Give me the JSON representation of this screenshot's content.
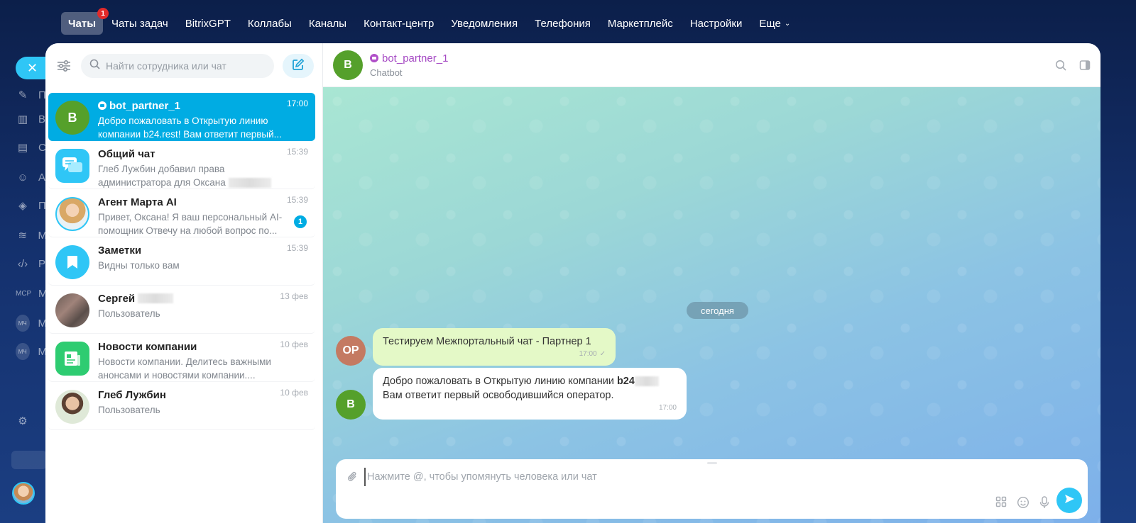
{
  "topnav": {
    "items": [
      {
        "label": "Чаты",
        "badge": "1"
      },
      {
        "label": "Чаты задач"
      },
      {
        "label": "BitrixGPT"
      },
      {
        "label": "Коллабы"
      },
      {
        "label": "Каналы"
      },
      {
        "label": "Контакт-центр"
      },
      {
        "label": "Уведомления"
      },
      {
        "label": "Телефония"
      },
      {
        "label": "Маркетплейс"
      },
      {
        "label": "Настройки"
      },
      {
        "label": "Еще"
      }
    ]
  },
  "rail": {
    "letters": [
      "П",
      "В",
      "С",
      "А",
      "П",
      "М",
      "Р",
      "М",
      "М",
      "М"
    ],
    "mcp": "MCP",
    "mch": "МЧ"
  },
  "sidebar": {
    "search_placeholder": "Найти сотрудника или чат",
    "chats": [
      {
        "name": "bot_partner_1",
        "time": "17:00",
        "preview": "Добро пожаловать в Открытую линию компании b24.rest! Вам ответит первый...",
        "avatar_letter": "B",
        "avatar_color": "#55a02b",
        "is_bot": true,
        "active": true
      },
      {
        "name": "Общий чат",
        "time": "15:39",
        "preview": "Глеб Лужбин добавил права администратора для Оксана",
        "avatar_icon": "general-chat-icon",
        "avatar_color": "#2fc6f6"
      },
      {
        "name": "Агент Марта AI",
        "time": "15:39",
        "preview": "Привет, Оксана! Я ваш персональный AI-помощник Отвечу на любой вопрос по...",
        "avatar_icon": "marta-photo",
        "unread": "1"
      },
      {
        "name": "Заметки",
        "time": "15:39",
        "preview": "Видны только вам",
        "avatar_icon": "bookmark-icon",
        "avatar_color": "#2fc6f6"
      },
      {
        "name": "Сергей",
        "time": "13 фев",
        "preview": "Пользователь",
        "avatar_icon": "user-photo-blurred"
      },
      {
        "name": "Новости компании",
        "time": "10 фев",
        "preview": "Новости компании. Делитесь важными анонсами и новостями компании....",
        "avatar_icon": "news-icon",
        "avatar_color": "#2ecc71"
      },
      {
        "name": "Глеб Лужбин",
        "time": "10 фев",
        "preview": "Пользователь",
        "avatar_icon": "user-photo"
      }
    ]
  },
  "chat": {
    "title": "bot_partner_1",
    "subtitle": "Chatbot",
    "avatar_letter": "B",
    "date_chip": "сегодня",
    "messages": [
      {
        "author_initials": "OP",
        "author_color": "#c47a62",
        "text": "Тестируем Межпортальный чат - Партнер 1",
        "time": "17:00",
        "style": "outgoing"
      },
      {
        "author_initials": "B",
        "author_color": "#55a02b",
        "text_line1": "Добро пожаловать в Открытую линию компании ",
        "text_bold": "b24",
        "text_line2": "Вам ответит первый освободившийся оператор.",
        "time": "17:00",
        "style": "incoming"
      }
    ],
    "composer_placeholder": "Нажмите @, чтобы упомянуть человека или чат"
  }
}
